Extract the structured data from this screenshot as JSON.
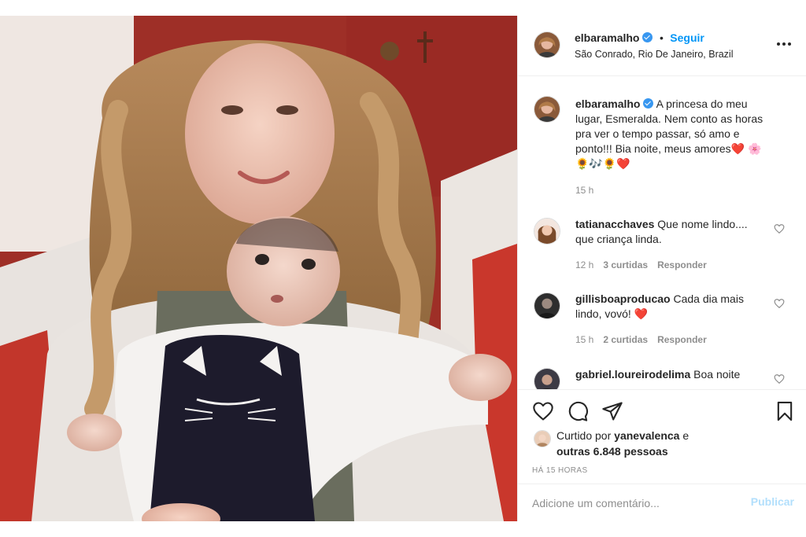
{
  "post": {
    "image_alt": "photo-of-woman-holding-baby"
  },
  "header": {
    "username": "elbaramalho",
    "follow_label": "Seguir",
    "location": "São Conrado, Rio De Janeiro, Brazil",
    "more_icon": "more-horizontal-icon"
  },
  "caption": {
    "username": "elbaramalho",
    "line1": "A princesa do meu",
    "line2": "lugar, Esmeralda. Nem conto as horas",
    "line3": "pra ver o tempo passar, só amo e",
    "line4": "ponto!!! Bia noite, meus amores❤️ 🌸",
    "line5": "🌻🎶🌻❤️",
    "time": "15 h"
  },
  "comments": [
    {
      "username": "tatianacchaves",
      "text_line1": "Que nome lindo....",
      "text_line2": "que criança linda.",
      "time": "12 h",
      "likes": "3 curtidas",
      "reply_label": "Responder"
    },
    {
      "username": "gillisboaproducao",
      "text_line1": "Cada dia mais",
      "text_line2": "lindo, vovó! ❤️",
      "time": "15 h",
      "likes": "2 curtidas",
      "reply_label": "Responder"
    },
    {
      "username": "gabriel.loureirodelima",
      "text_line1": "Boa noite"
    }
  ],
  "actions": {
    "like_icon": "heart-icon",
    "comment_icon": "comment-icon",
    "share_icon": "share-icon",
    "save_icon": "bookmark-icon"
  },
  "likes": {
    "prefix": "Curtido por",
    "liked_by": "yanevalenca",
    "conjunction": "e",
    "others": "outras 6.848 pessoas"
  },
  "posted_ago": "HÁ 15 HORAS",
  "add_comment": {
    "placeholder": "Adicione um comentário...",
    "publish_label": "Publicar"
  },
  "colors": {
    "link_blue": "#0095f6",
    "publish_disabled": "#b2dffc",
    "heart_red": "#ed4956",
    "muted": "#8e8e8e"
  }
}
